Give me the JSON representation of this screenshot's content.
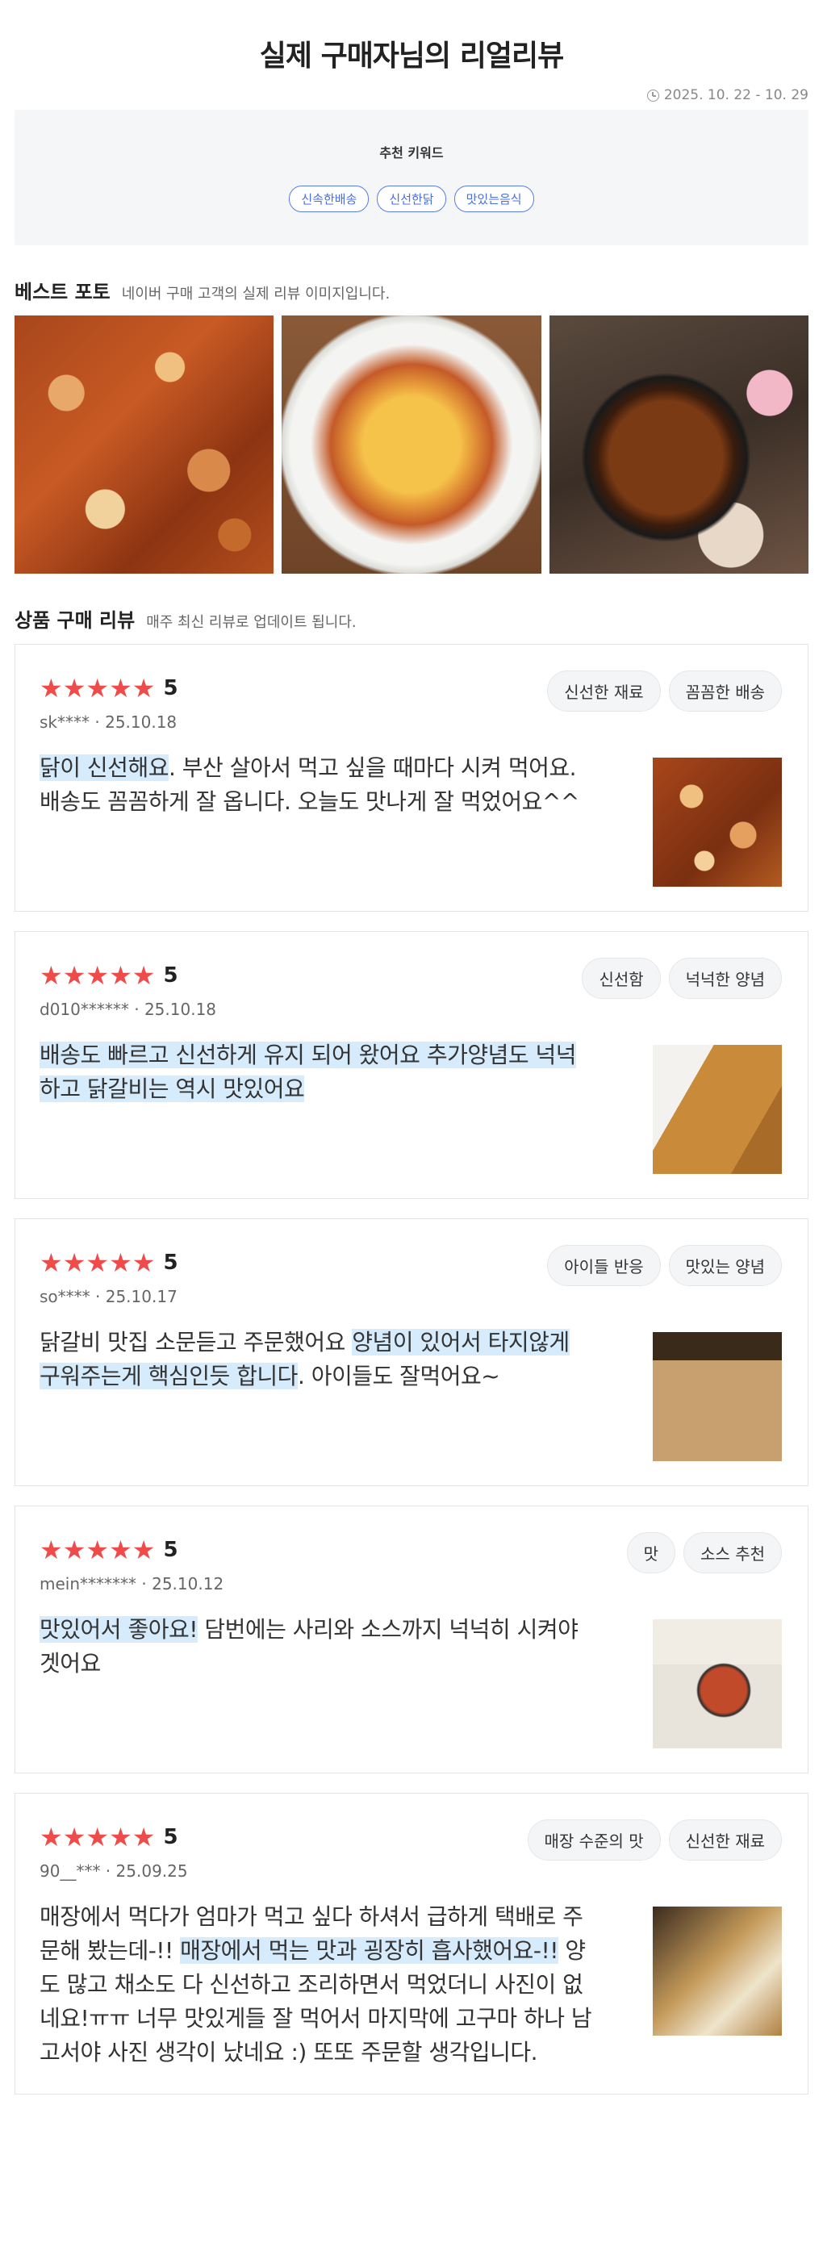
{
  "header": {
    "title": "실제 구매자님의 리얼리뷰",
    "period": "2025. 10. 22 - 10. 29"
  },
  "keywords": {
    "title": "추천 키워드",
    "items": [
      "신속한배송",
      "신선한닭",
      "맛있는음식"
    ]
  },
  "best_photos": {
    "title": "베스트 포토",
    "subtitle": "네이버 구매 고객의 실제 리뷰 이미지입니다."
  },
  "reviews_section": {
    "title": "상품 구매 리뷰",
    "subtitle": "매주 최신 리뷰로 업데이트 됩니다."
  },
  "reviews": [
    {
      "stars": "★★★★★",
      "score": "5",
      "user": "sk****",
      "date": "25.10.18",
      "tags": [
        "신선한 재료",
        "꼼꼼한 배송"
      ],
      "text_hl1": "닭이 신선해요",
      "text_rest1": ". 부산 살아서 먹고 싶을 때마다 시켜 먹어요. 배송도 꼼꼼하게 잘 옵니다. 오늘도 맛나게 잘 먹었어요^^"
    },
    {
      "stars": "★★★★★",
      "score": "5",
      "user": "d010******",
      "date": "25.10.18",
      "tags": [
        "신선함",
        "넉넉한 양념"
      ],
      "text_hl1": "배송도 빠르고 신선하게 유지 되어 왔어요 추가양념도 넉넉하고 닭갈비는 역시 맛있어요"
    },
    {
      "stars": "★★★★★",
      "score": "5",
      "user": "so****",
      "date": "25.10.17",
      "tags": [
        "아이들 반응",
        "맛있는 양념"
      ],
      "text_pre": "닭갈비 맛집 소문듣고 주문했어요 ",
      "text_hl1": "양념이 있어서 타지않게 구워주는게 핵심인듯 합니다",
      "text_rest1": ". 아이들도 잘먹어요~"
    },
    {
      "stars": "★★★★★",
      "score": "5",
      "user": "mein*******",
      "date": "25.10.12",
      "tags": [
        "맛",
        "소스 추천"
      ],
      "text_hl1": "맛있어서 좋아요!",
      "text_rest1": " 담번에는 사리와 소스까지 넉넉히 시켜야겟어요"
    },
    {
      "stars": "★★★★★",
      "score": "5",
      "user": "90__***",
      "date": "25.09.25",
      "tags": [
        "매장 수준의 맛",
        "신선한 재료"
      ],
      "text_pre": "매장에서 먹다가 엄마가 먹고 싶다 하셔서 급하게 택배로 주문해 봤는데-!! ",
      "text_hl1": "매장에서 먹는 맛과 굉장히 흡사했어요-!!",
      "text_rest1": " 양도 많고 채소도 다 신선하고 조리하면서 먹었더니 사진이 없네요!ㅠㅠ 너무 맛있게들 잘 먹어서 마지막에 고구마 하나 남고서야 사진 생각이 났네요 :) 또또 주문할 생각입니다."
    }
  ],
  "colors": {
    "star": "#ef4b4b",
    "highlight": "#d6ebfb",
    "keyword_border": "#5a7de8"
  }
}
